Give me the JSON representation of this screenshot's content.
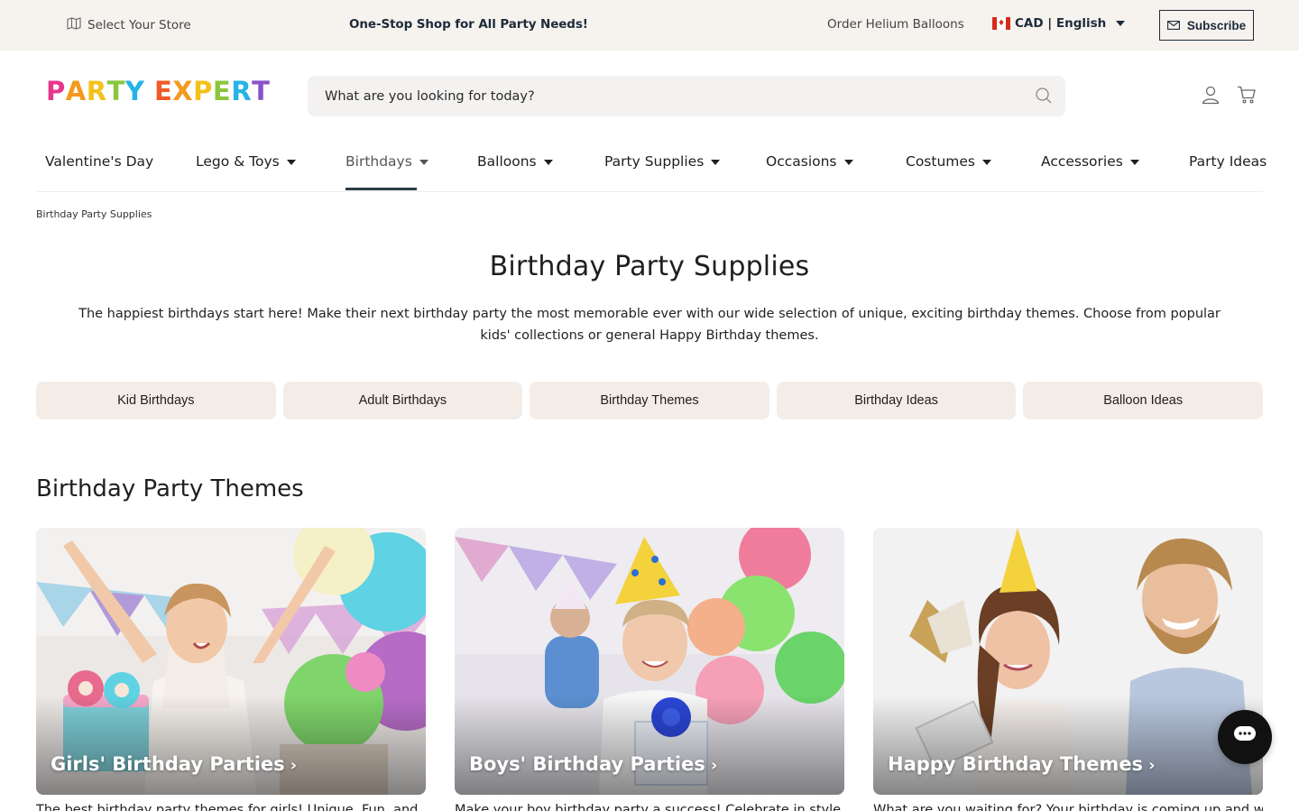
{
  "topbar": {
    "store_label": "Select Your Store",
    "promo": "One-Stop Shop for All Party Needs!",
    "helium": "Order Helium Balloons",
    "currency": "CAD | English",
    "subscribe": "Subscribe"
  },
  "logo": {
    "letters": [
      "P",
      "A",
      "R",
      "T",
      "Y",
      " ",
      "E",
      "X",
      "P",
      "E",
      "R",
      "T"
    ],
    "colors": [
      "#e8358e",
      "#f39a1f",
      "#f2c21a",
      "#8cc63f",
      "#26b3e6",
      "#ffffff",
      "#f05a28",
      "#f39a1f",
      "#f2c21a",
      "#8cc63f",
      "#26b3e6",
      "#8a52c8"
    ]
  },
  "search": {
    "placeholder": "What are you looking for today?"
  },
  "nav": {
    "items": [
      {
        "label": "Valentine's Day",
        "dropdown": false
      },
      {
        "label": "Lego & Toys",
        "dropdown": true
      },
      {
        "label": "Birthdays",
        "dropdown": true,
        "active": true
      },
      {
        "label": "Balloons",
        "dropdown": true
      },
      {
        "label": "Party Supplies",
        "dropdown": true
      },
      {
        "label": "Occasions",
        "dropdown": true
      },
      {
        "label": "Costumes",
        "dropdown": true
      },
      {
        "label": "Accessories",
        "dropdown": true
      },
      {
        "label": "Party Ideas",
        "dropdown": false
      }
    ]
  },
  "breadcrumb": "Birthday Party Supplies",
  "page": {
    "title": "Birthday Party Supplies",
    "intro": "The happiest birthdays start here! Make their next birthday party the most memorable ever with our wide selection of unique, exciting birthday themes. Choose from popular kids' collections or general Happy Birthday themes."
  },
  "pills": [
    "Kid Birthdays",
    "Adult Birthdays",
    "Birthday Themes",
    "Birthday Ideas",
    "Balloon Ideas"
  ],
  "themes": {
    "title": "Birthday Party Themes",
    "cards": [
      {
        "label": "Girls' Birthday Parties",
        "chevron": "›",
        "desc": "The best birthday party themes for girls! Unique, Fun, and"
      },
      {
        "label": "Boys' Birthday Parties",
        "chevron": "›",
        "desc": "Make your boy birthday party a success! Celebrate in style with"
      },
      {
        "label": "Happy Birthday Themes",
        "chevron": "›",
        "desc": "What are you waiting for? Your birthday is coming up and we"
      }
    ]
  },
  "colors": {
    "topbar_bg": "#f6f2ee",
    "pill_bg": "#f4ede7",
    "accent": "#1c2b3a",
    "nav_underline": "#2c3e44"
  }
}
